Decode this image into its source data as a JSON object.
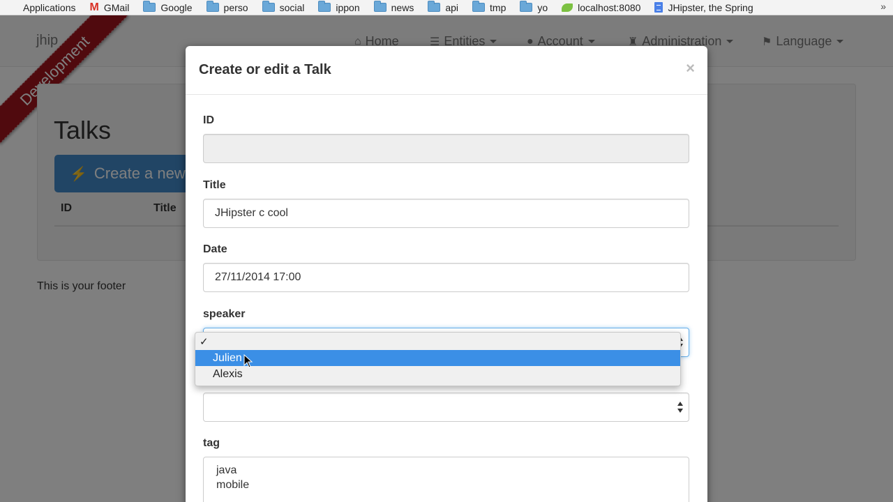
{
  "bookmarks": {
    "items": [
      "Applications",
      "GMail",
      "Google",
      "perso",
      "social",
      "ippon",
      "news",
      "api",
      "tmp",
      "yo",
      "localhost:8080",
      "JHipster, the Spring"
    ],
    "more": "»"
  },
  "navbar": {
    "brand": "jhip",
    "ribbon": "Development",
    "home": "Home",
    "entities": "Entities",
    "account": "Account",
    "administration": "Administration",
    "language": "Language"
  },
  "page": {
    "title": "Talks",
    "create_button": "Create a new",
    "columns": [
      "ID",
      "Title"
    ],
    "footer": "This is your footer"
  },
  "modal": {
    "title": "Create or edit a Talk",
    "close": "×",
    "fields": {
      "id_label": "ID",
      "id_value": "",
      "title_label": "Title",
      "title_value": "JHipster c cool",
      "date_label": "Date",
      "date_value": "27/11/2014  17:00",
      "speaker_label": "speaker",
      "speaker_value": "",
      "second_select_value": "",
      "tag_label": "tag",
      "tag_values": [
        "java",
        "mobile"
      ]
    }
  },
  "speaker_dropdown": {
    "check": "✓",
    "options": [
      "",
      "Julien",
      "Alexis"
    ],
    "highlighted": "Julien"
  },
  "colors": {
    "ribbon": "#a0151c",
    "primary": "#428bca",
    "dropdown_highlight": "#3b8fe6"
  }
}
